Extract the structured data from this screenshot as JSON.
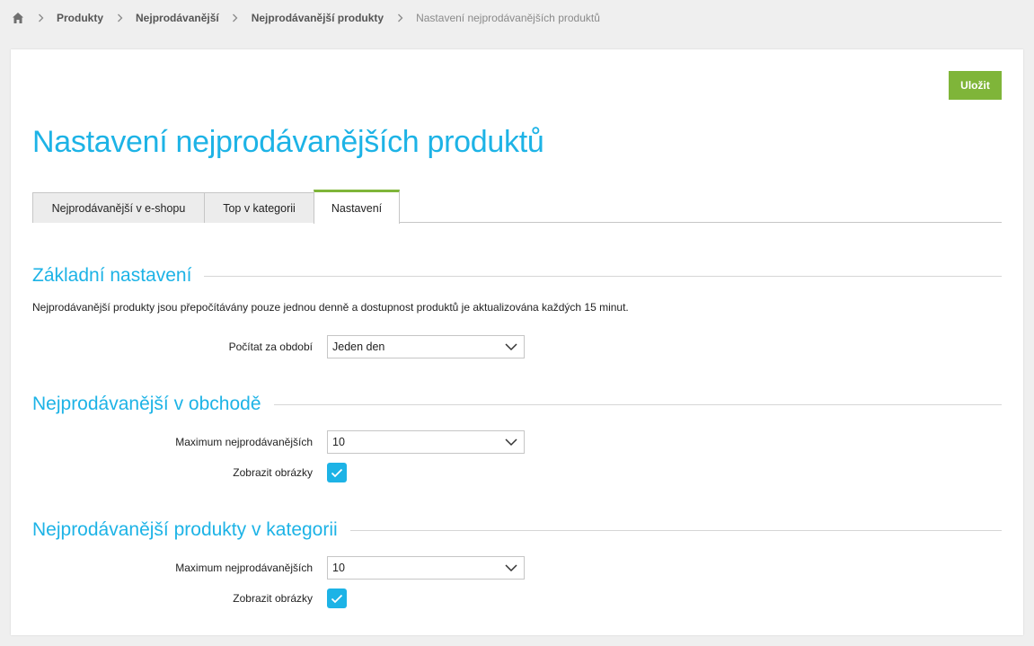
{
  "breadcrumb": {
    "home_icon": "home-icon",
    "items": [
      {
        "label": "Produkty"
      },
      {
        "label": "Nejprodávanější"
      },
      {
        "label": "Nejprodávanější produkty"
      }
    ],
    "current": "Nastavení nejprodávanějších produktů"
  },
  "toolbar": {
    "save_label": "Uložit"
  },
  "page": {
    "title": "Nastavení nejprodávanějších produktů"
  },
  "tabs": [
    {
      "label": "Nejprodávanější v e-shopu",
      "active": false
    },
    {
      "label": "Top v kategorii",
      "active": false
    },
    {
      "label": "Nastavení",
      "active": true
    }
  ],
  "sections": {
    "basic": {
      "title": "Základní nastavení",
      "info": "Nejprodávanější produkty jsou přepočítávány pouze jednou denně a dostupnost produktů je aktualizována každých 15 minut.",
      "period_label": "Počítat za období",
      "period_value": "Jeden den"
    },
    "shop": {
      "title": "Nejprodávanější v obchodě",
      "max_label": "Maximum nejprodávanějších",
      "max_value": "10",
      "images_label": "Zobrazit obrázky",
      "images_checked": true
    },
    "category": {
      "title": "Nejprodávanější produkty v kategorii",
      "max_label": "Maximum nejprodávanějších",
      "max_value": "10",
      "images_label": "Zobrazit obrázky",
      "images_checked": true
    }
  },
  "colors": {
    "accent_blue": "#1db3e6",
    "accent_green": "#7fb539",
    "background": "#efefef"
  }
}
